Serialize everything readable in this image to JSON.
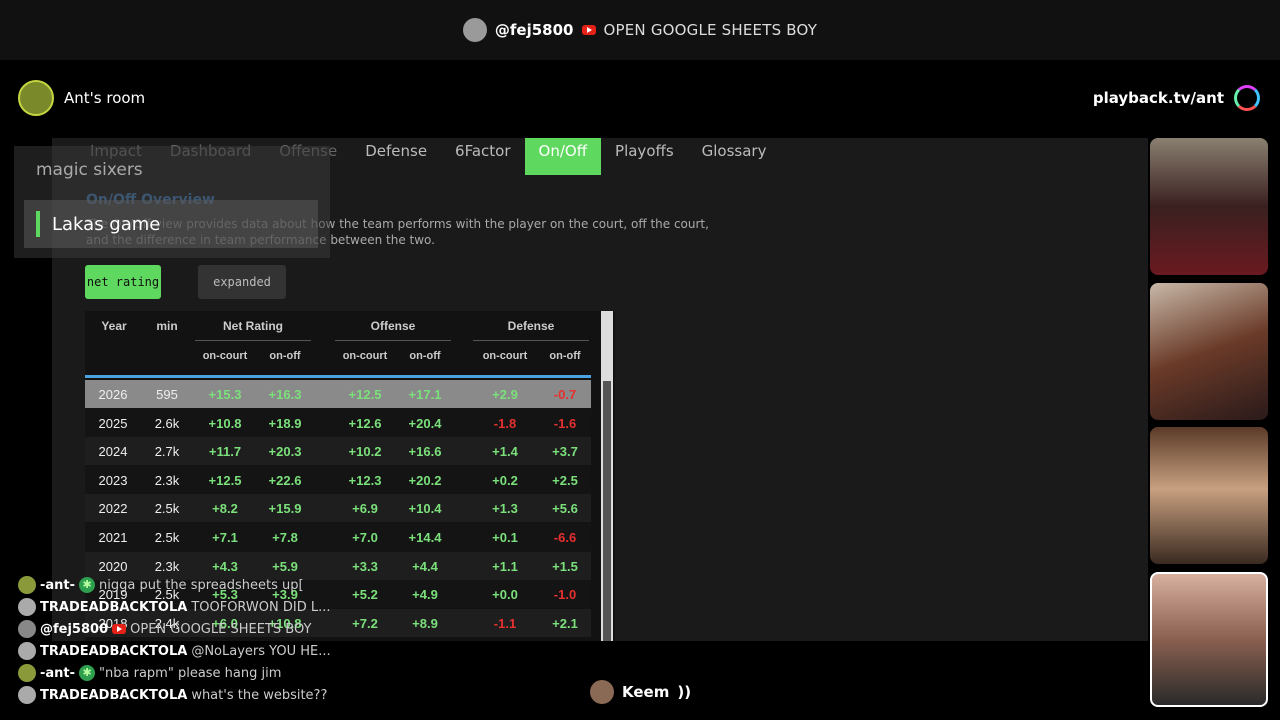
{
  "top": {
    "user": "@fej5800",
    "message": "OPEN GOOGLE SHEETS BOY"
  },
  "room": {
    "name": "Ant's room"
  },
  "site": {
    "url": "playback.tv/ant"
  },
  "tabs": [
    "Impact",
    "Dashboard",
    "Offense",
    "Defense",
    "6Factor",
    "On/Off",
    "Playoffs",
    "Glossary"
  ],
  "active_tab": "On/Off",
  "overview": {
    "title": "On/Off Overview",
    "desc": "The On/Off view provides data about how the team performs with the player on the court, off the court, and the difference in team performance between the two."
  },
  "buttons": {
    "net": "net rating",
    "expanded": "expanded"
  },
  "menu": {
    "item1": "magic sixers",
    "item2": "Lakas game"
  },
  "table": {
    "headers": {
      "year": "Year",
      "min": "min",
      "net": "Net Rating",
      "off": "Offense",
      "def": "Defense",
      "oncourt": "on-court",
      "onoff": "on-off"
    },
    "rows": [
      {
        "year": "2026",
        "min": "595",
        "v": [
          "+15.3",
          "+16.3",
          "+12.5",
          "+17.1",
          "+2.9",
          "-0.7"
        ]
      },
      {
        "year": "2025",
        "min": "2.6k",
        "v": [
          "+10.8",
          "+18.9",
          "+12.6",
          "+20.4",
          "-1.8",
          "-1.6"
        ]
      },
      {
        "year": "2024",
        "min": "2.7k",
        "v": [
          "+11.7",
          "+20.3",
          "+10.2",
          "+16.6",
          "+1.4",
          "+3.7"
        ]
      },
      {
        "year": "2023",
        "min": "2.3k",
        "v": [
          "+12.5",
          "+22.6",
          "+12.3",
          "+20.2",
          "+0.2",
          "+2.5"
        ]
      },
      {
        "year": "2022",
        "min": "2.5k",
        "v": [
          "+8.2",
          "+15.9",
          "+6.9",
          "+10.4",
          "+1.3",
          "+5.6"
        ]
      },
      {
        "year": "2021",
        "min": "2.5k",
        "v": [
          "+7.1",
          "+7.8",
          "+7.0",
          "+14.4",
          "+0.1",
          "-6.6"
        ]
      },
      {
        "year": "2020",
        "min": "2.3k",
        "v": [
          "+4.3",
          "+5.9",
          "+3.3",
          "+4.4",
          "+1.1",
          "+1.5"
        ]
      },
      {
        "year": "2019",
        "min": "2.5k",
        "v": [
          "+5.3",
          "+3.9",
          "+5.2",
          "+4.9",
          "+0.0",
          "-1.0"
        ]
      },
      {
        "year": "2018",
        "min": "2.4k",
        "v": [
          "+6.0",
          "+10.8",
          "+7.2",
          "+8.9",
          "-1.1",
          "+2.1"
        ]
      }
    ]
  },
  "chat": [
    {
      "name": "-ant-",
      "badge": "✱",
      "text": "nigga put the spreadsheets up["
    },
    {
      "name": "TRADEADBACKTOLA",
      "text": "TOOFORWON DID L..."
    },
    {
      "name": "@fej5800",
      "yt": true,
      "text": "OPEN GOOGLE SHEETS BOY"
    },
    {
      "name": "TRADEADBACKTOLA",
      "text": "@NoLayers YOU HE..."
    },
    {
      "name": "-ant-",
      "badge": "✱",
      "text": "\"nba rapm\" please hang jim"
    },
    {
      "name": "TRADEADBACKTOLA",
      "text": "what's the website??"
    }
  ],
  "speaker": {
    "name": "Keem"
  },
  "colors": {
    "accent": "#5ed85e",
    "positive": "#7be07b",
    "negative": "#e63030",
    "title_blue": "#3d6fa5"
  }
}
